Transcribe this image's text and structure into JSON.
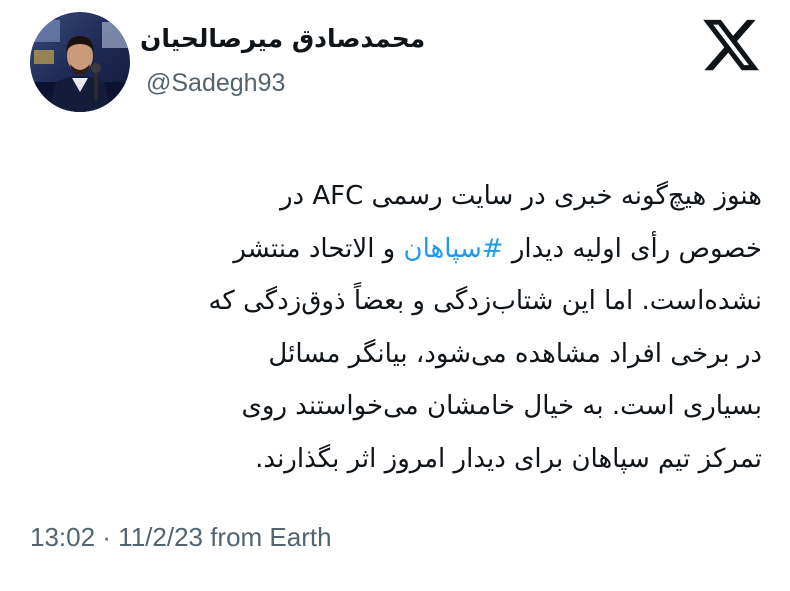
{
  "author": {
    "display_name": "محمدصادق میرصالحیان",
    "handle": "@Sadegh93"
  },
  "icons": {
    "brand": "x-logo-icon",
    "avatar": "profile-photo"
  },
  "tweet": {
    "lines": [
      {
        "before": "هنوز هیچ‌گونه خبری در سایت رسمی AFC در",
        "hashtag": "",
        "after": ""
      },
      {
        "before": "خصوص رأی اولیه دیدار ",
        "hashtag": "#سپاهان",
        "after": " و الاتحاد منتشر"
      },
      {
        "before": "نشده‌است. اما این شتاب‌زدگی و بعضاً ذوق‌زدگی که",
        "hashtag": "",
        "after": ""
      },
      {
        "before": "در برخی افراد مشاهده می‌شود، بیانگر مسائل",
        "hashtag": "",
        "after": ""
      },
      {
        "before": "بسیاری است. به خیال خامشان می‌خواستند روی",
        "hashtag": "",
        "after": ""
      },
      {
        "before": "تمرکز تیم سپاهان برای دیدار امروز اثر بگذارند.",
        "hashtag": "",
        "after": ""
      }
    ]
  },
  "meta": {
    "timestamp": "13:02 · 11/2/23 from Earth"
  },
  "colors": {
    "text": "#0f1419",
    "secondary": "#536471",
    "link": "#1d9bf0",
    "background": "#ffffff"
  }
}
